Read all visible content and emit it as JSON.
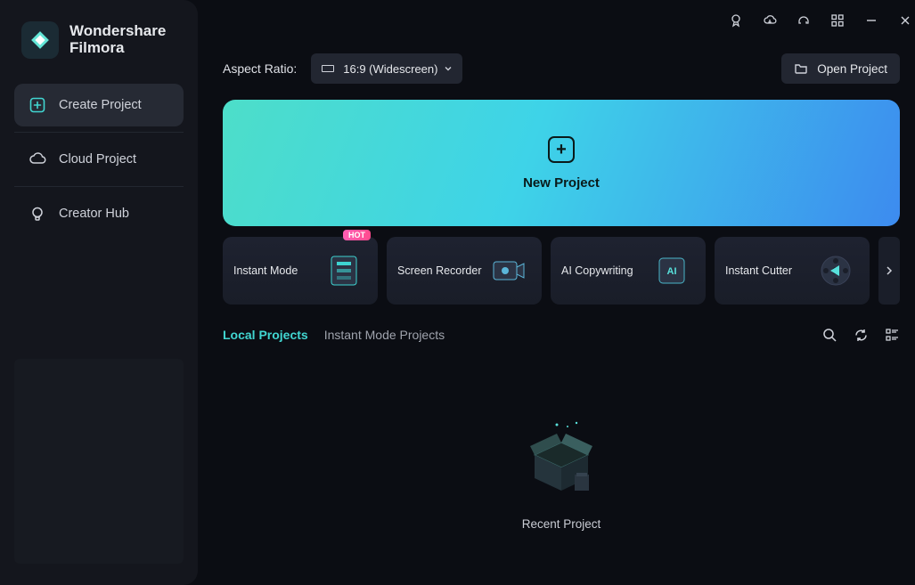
{
  "brand": {
    "line1": "Wondershare",
    "line2": "Filmora"
  },
  "sidebar": {
    "items": [
      {
        "label": "Create Project"
      },
      {
        "label": "Cloud Project"
      },
      {
        "label": "Creator Hub"
      }
    ]
  },
  "toolbar": {
    "aspect_label": "Aspect Ratio:",
    "aspect_value": "16:9 (Widescreen)",
    "open_label": "Open Project"
  },
  "hero": {
    "label": "New Project"
  },
  "cards": [
    {
      "label": "Instant Mode",
      "badge": "HOT"
    },
    {
      "label": "Screen Recorder"
    },
    {
      "label": "AI Copywriting"
    },
    {
      "label": "Instant Cutter"
    }
  ],
  "tabs": [
    {
      "label": "Local Projects",
      "active": true
    },
    {
      "label": "Instant Mode Projects",
      "active": false
    }
  ],
  "empty": {
    "label": "Recent Project"
  }
}
